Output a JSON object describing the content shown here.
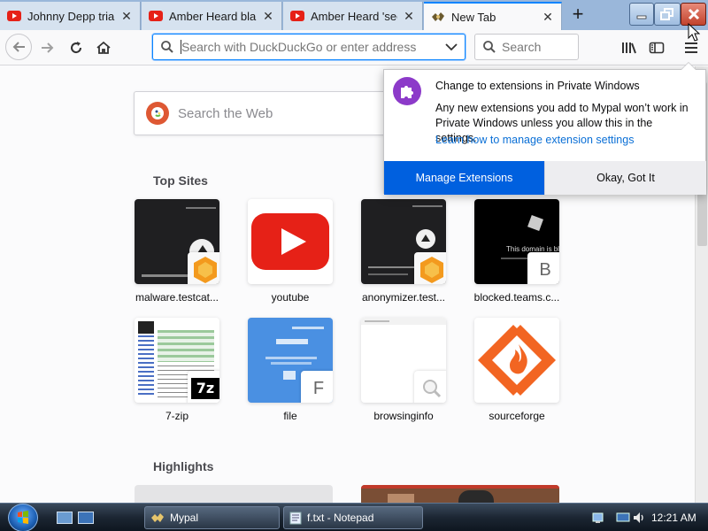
{
  "tabs": [
    {
      "title": "Johnny Depp trial:",
      "favicon": "youtube-icon",
      "active": false
    },
    {
      "title": "Amber Heard blam",
      "favicon": "youtube-icon",
      "active": false
    },
    {
      "title": "Amber Heard 'seen",
      "favicon": "youtube-icon",
      "active": false
    },
    {
      "title": "New Tab",
      "favicon": "mypal-icon",
      "active": true
    }
  ],
  "new_tab_label": "+",
  "toolbar": {
    "url_placeholder": "Search with DuckDuckGo or enter address",
    "search_placeholder": "Search"
  },
  "newtab": {
    "web_search_placeholder": "Search the Web",
    "top_sites_title": "Top Sites",
    "highlights_title": "Highlights",
    "top_sites": [
      {
        "label": "malware.testcat...",
        "badge": ""
      },
      {
        "label": "youtube",
        "badge": ""
      },
      {
        "label": "anonymizer.test...",
        "badge": ""
      },
      {
        "label": "blocked.teams.c...",
        "badge": "B"
      },
      {
        "label": "7-zip",
        "badge": ""
      },
      {
        "label": "file",
        "badge": "F"
      },
      {
        "label": "browsinginfo",
        "badge": ""
      },
      {
        "label": "sourceforge",
        "badge": ""
      }
    ]
  },
  "popup": {
    "title": "Change to extensions in Private Windows",
    "body": "Any new extensions you add to Mypal won’t work in Private Windows unless you allow this in the settings.",
    "link": "Learn how to manage extension settings",
    "primary_button": "Manage Extensions",
    "secondary_button": "Okay, Got It"
  },
  "taskbar": {
    "items": [
      {
        "label": "Mypal",
        "icon": "mypal-icon"
      },
      {
        "label": "f.txt - Notepad",
        "icon": "notepad-icon"
      }
    ],
    "clock": "12:21 AM"
  },
  "colors": {
    "accent": "#0a84ff",
    "primary_button": "#0060df",
    "youtube_red": "#e62117",
    "sourceforge_orange": "#f26522",
    "puzzle_purple": "#8c3ac9"
  }
}
